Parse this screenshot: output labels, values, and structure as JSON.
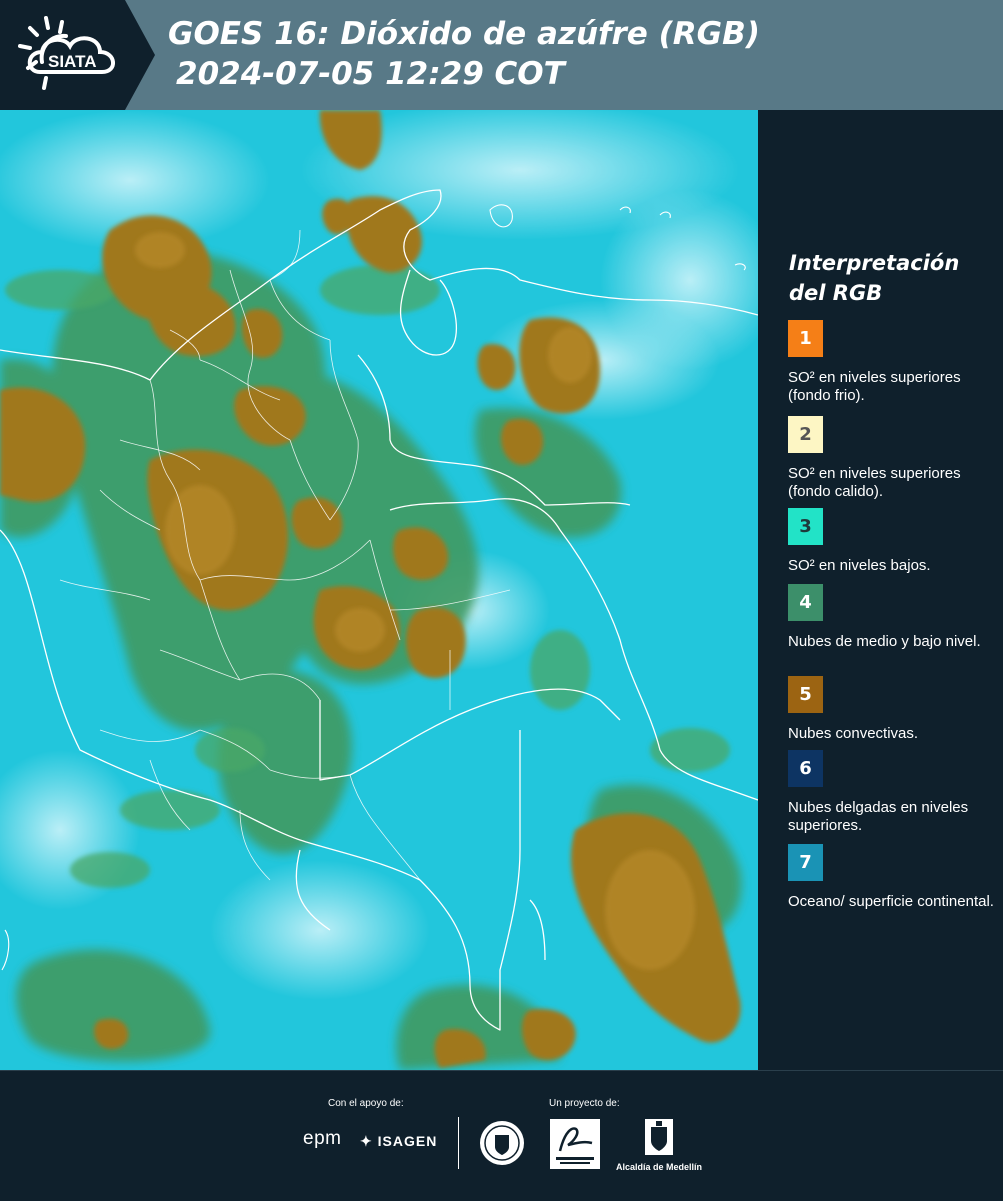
{
  "header": {
    "logo_text": "SIATA",
    "title_line_1": "GOES 16: Dióxido de azúfre (RGB)",
    "title_line_2": "2024-07-05 12:29 COT"
  },
  "legend": {
    "title": "Interpretación del RGB",
    "items": [
      {
        "number": "1",
        "label": "SO² en niveles superiores (fondo frio).",
        "color": "#f57f17",
        "text_color": "#ffffff"
      },
      {
        "number": "2",
        "label": "SO² en niveles superiores (fondo calido).",
        "color": "#fdf6c4",
        "text_color": "#555555"
      },
      {
        "number": "3",
        "label": "SO² en niveles bajos.",
        "color": "#22e3c7",
        "text_color": "#1e3a3a"
      },
      {
        "number": "4",
        "label": "Nubes de medio y bajo nivel.",
        "color": "#3c8f6a",
        "text_color": "#ffffff"
      },
      {
        "number": "5",
        "label": "Nubes convectivas.",
        "color": "#9c6412",
        "text_color": "#ffffff"
      },
      {
        "number": "6",
        "label": "Nubes delgadas en niveles superiores.",
        "color": "#0d3463",
        "text_color": "#ffffff"
      },
      {
        "number": "7",
        "label": "Oceano/ superficie continental.",
        "color": "#1a93b5",
        "text_color": "#ffffff"
      }
    ]
  },
  "footer": {
    "support_label": "Con el apoyo de:",
    "project_label": "Un proyecto de:",
    "sponsor_1": "epm",
    "sponsor_2": "ISAGEN",
    "partner_area": "Área Metropolitana Valle de Aburrá",
    "partner_alcaldia": "Alcaldía de Medellín"
  },
  "colors": {
    "header_bg": "#587987",
    "page_bg": "#0f202c",
    "map_cyan": "#22c6dc",
    "map_green": "#3f9a62",
    "map_brown": "#a0781f"
  }
}
